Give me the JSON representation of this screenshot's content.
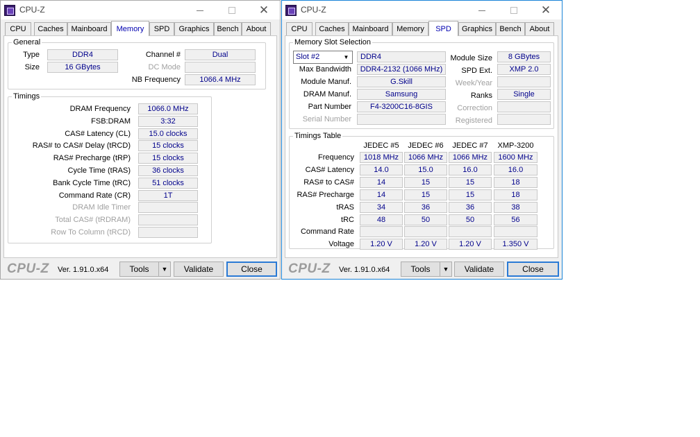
{
  "app": {
    "title": "CPU-Z",
    "logo": "CPU-Z",
    "version": "Ver. 1.91.0.x64"
  },
  "tabs": [
    {
      "label": "CPU"
    },
    {
      "label": "Caches"
    },
    {
      "label": "Mainboard"
    },
    {
      "label": "Memory"
    },
    {
      "label": "SPD"
    },
    {
      "label": "Graphics"
    },
    {
      "label": "Bench"
    },
    {
      "label": "About"
    }
  ],
  "footer": {
    "tools": "Tools",
    "tools_arrow": "▼",
    "validate": "Validate",
    "close": "Close"
  },
  "titlebar": {
    "close_glyph": "✕"
  },
  "memory": {
    "active_tab": "Memory",
    "general": {
      "label": "General",
      "type_label": "Type",
      "type": "DDR4",
      "size_label": "Size",
      "size": "16 GBytes",
      "channel_label": "Channel #",
      "channel": "Dual",
      "dc_mode_label": "DC Mode",
      "dc_mode": "",
      "nb_freq_label": "NB Frequency",
      "nb_freq": "1066.4 MHz"
    },
    "timings": {
      "label": "Timings",
      "rows": [
        {
          "label": "DRAM Frequency",
          "value": "1066.0 MHz",
          "disabled": false
        },
        {
          "label": "FSB:DRAM",
          "value": "3:32",
          "disabled": false
        },
        {
          "label": "CAS# Latency (CL)",
          "value": "15.0 clocks",
          "disabled": false
        },
        {
          "label": "RAS# to CAS# Delay (tRCD)",
          "value": "15 clocks",
          "disabled": false
        },
        {
          "label": "RAS# Precharge (tRP)",
          "value": "15 clocks",
          "disabled": false
        },
        {
          "label": "Cycle Time (tRAS)",
          "value": "36 clocks",
          "disabled": false
        },
        {
          "label": "Bank Cycle Time (tRC)",
          "value": "51 clocks",
          "disabled": false
        },
        {
          "label": "Command Rate (CR)",
          "value": "1T",
          "disabled": false
        },
        {
          "label": "DRAM Idle Timer",
          "value": "",
          "disabled": true
        },
        {
          "label": "Total CAS# (tRDRAM)",
          "value": "",
          "disabled": true
        },
        {
          "label": "Row To Column (tRCD)",
          "value": "",
          "disabled": true
        }
      ]
    }
  },
  "spd": {
    "active_tab": "SPD",
    "slot_selection": {
      "label": "Memory Slot Selection",
      "slot": "Slot #2",
      "type": "DDR4",
      "max_bw_label": "Max Bandwidth",
      "max_bw": "DDR4-2132 (1066 MHz)",
      "module_manuf_label": "Module Manuf.",
      "module_manuf": "G.Skill",
      "dram_manuf_label": "DRAM Manuf.",
      "dram_manuf": "Samsung",
      "part_number_label": "Part Number",
      "part_number": "F4-3200C16-8GIS",
      "serial_label": "Serial Number",
      "serial": "",
      "module_size_label": "Module Size",
      "module_size": "8 GBytes",
      "spd_ext_label": "SPD Ext.",
      "spd_ext": "XMP 2.0",
      "week_year_label": "Week/Year",
      "week_year": "",
      "ranks_label": "Ranks",
      "ranks": "Single",
      "correction_label": "Correction",
      "correction": "",
      "registered_label": "Registered",
      "registered": ""
    },
    "timings_table": {
      "label": "Timings Table",
      "columns": [
        "JEDEC #5",
        "JEDEC #6",
        "JEDEC #7",
        "XMP-3200"
      ],
      "rows": [
        {
          "label": "Frequency",
          "values": [
            "1018 MHz",
            "1066 MHz",
            "1066 MHz",
            "1600 MHz"
          ]
        },
        {
          "label": "CAS# Latency",
          "values": [
            "14.0",
            "15.0",
            "16.0",
            "16.0"
          ]
        },
        {
          "label": "RAS# to CAS#",
          "values": [
            "14",
            "15",
            "15",
            "18"
          ]
        },
        {
          "label": "RAS# Precharge",
          "values": [
            "14",
            "15",
            "15",
            "18"
          ]
        },
        {
          "label": "tRAS",
          "values": [
            "34",
            "36",
            "36",
            "38"
          ]
        },
        {
          "label": "tRC",
          "values": [
            "48",
            "50",
            "50",
            "56"
          ]
        },
        {
          "label": "Command Rate",
          "values": [
            "",
            "",
            "",
            ""
          ]
        },
        {
          "label": "Voltage",
          "values": [
            "1.20 V",
            "1.20 V",
            "1.20 V",
            "1.350 V"
          ]
        }
      ]
    }
  }
}
